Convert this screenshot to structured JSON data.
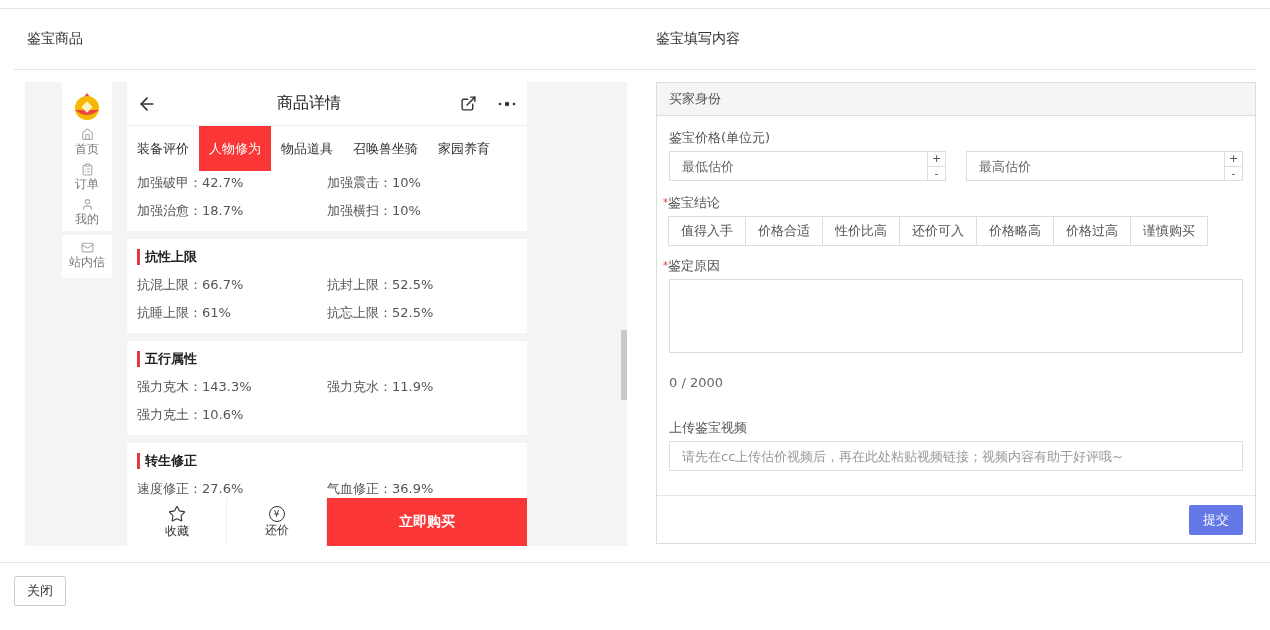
{
  "left_title": "鉴宝商品",
  "right_title": "鉴宝填写内容",
  "app": {
    "sidebar": [
      {
        "kind": "home",
        "label": "首页"
      },
      {
        "kind": "order",
        "label": "订单"
      },
      {
        "kind": "user",
        "label": "我的"
      },
      {
        "kind": "mail",
        "label": "站内信"
      }
    ],
    "title": "商品详情",
    "tabs": [
      {
        "label": "装备评价",
        "selected": false
      },
      {
        "label": "人物修为",
        "selected": true
      },
      {
        "label": "物品道具",
        "selected": false
      },
      {
        "label": "召唤兽坐骑",
        "selected": false
      },
      {
        "label": "家园养育",
        "selected": false
      }
    ],
    "sections": [
      {
        "stats": [
          "加强破甲：42.7%",
          "加强震击：10%",
          "加强治愈：18.7%",
          "加强横扫：10%"
        ]
      },
      {
        "title": "抗性上限",
        "stats": [
          "抗混上限：66.7%",
          "抗封上限：52.5%",
          "抗睡上限：61%",
          "抗忘上限：52.5%"
        ]
      },
      {
        "title": "五行属性",
        "stats": [
          "强力克木：143.3%",
          "强力克水：11.9%",
          "强力克土：10.6%"
        ]
      },
      {
        "title": "转生修正",
        "stats": [
          "速度修正：27.6%",
          "气血修正：36.9%"
        ]
      }
    ],
    "favorite": "收藏",
    "bargain": "还价",
    "bargain_symbol": "¥",
    "buy": "立即购买"
  },
  "form": {
    "panel_title": "买家身份",
    "price_label": "鉴宝价格(单位元)",
    "min_placeholder": "最低估价",
    "max_placeholder": "最高估价",
    "plus": "+",
    "minus": "-",
    "conclusion_label": "鉴宝结论",
    "required_mark": "*",
    "conclusions": [
      {
        "label": "值得入手",
        "selected": false
      },
      {
        "label": "价格合适",
        "selected": false
      },
      {
        "label": "性价比高",
        "selected": false
      },
      {
        "label": "还价可入",
        "selected": false
      },
      {
        "label": "价格略高",
        "selected": false
      },
      {
        "label": "价格过高",
        "selected": false
      },
      {
        "label": "谨慎购买",
        "selected": false
      }
    ],
    "reason_label": "鉴定原因",
    "counter": "0 / 2000",
    "video_label": "上传鉴宝视频",
    "video_placeholder": "请先在cc上传估价视频后，再在此处粘贴视频链接；视频内容有助于好评哦~",
    "submit": "提交"
  },
  "footer": {
    "close": "关闭"
  }
}
